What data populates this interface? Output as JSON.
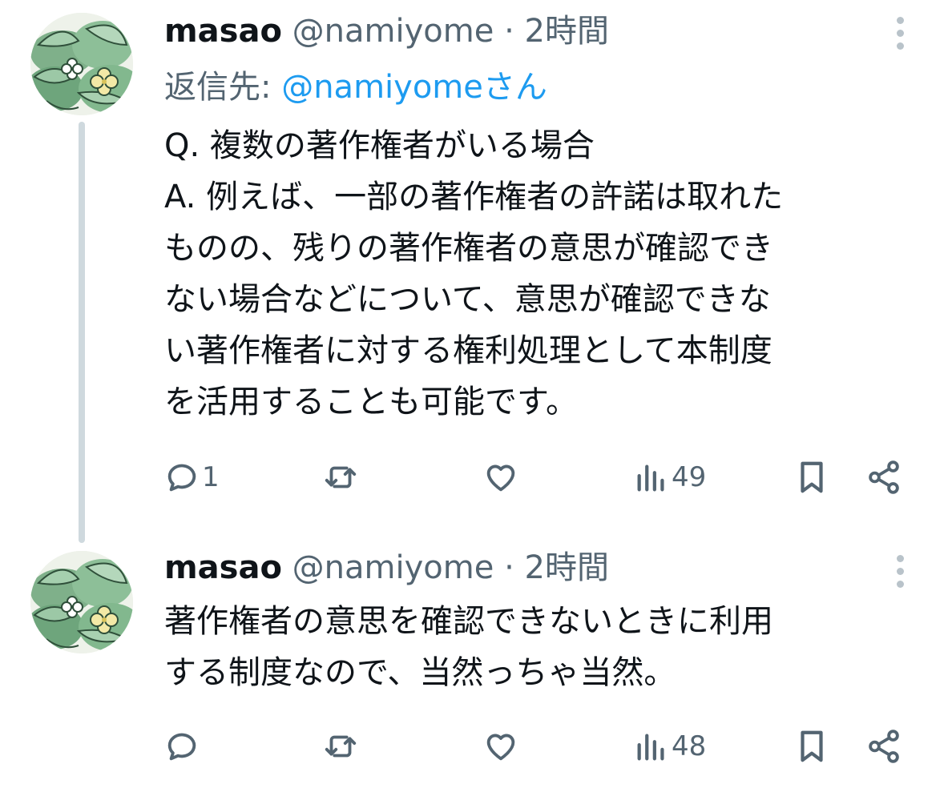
{
  "tweets": [
    {
      "display_name": "masao",
      "handle": "@namiyome",
      "separator": "·",
      "time": "2時間",
      "replying_prefix": "返信先:",
      "replying_to": "@namiyomeさん",
      "body_lines": [
        "Q. 複数の著作権者がいる場合",
        "A. 例えば、一部の著作権者の許諾は取れた",
        "ものの、残りの著作権者の意思が確認でき",
        "ない場合などについて、意思が確認できな",
        "い著作権者に対する権利処理として本制度",
        "を活用することも可能です。"
      ],
      "actions": {
        "reply_icon": "speech-bubble-icon",
        "reply_count": "1",
        "retweet_icon": "retweet-icon",
        "like_icon": "heart-icon",
        "views_icon": "bar-chart-icon",
        "views_count": "49",
        "bookmark_icon": "bookmark-icon",
        "share_icon": "share-icon"
      }
    },
    {
      "display_name": "masao",
      "handle": "@namiyome",
      "separator": "·",
      "time": "2時間",
      "body_lines": [
        "著作権者の意思を確認できないときに利用",
        "する制度なので、当然っちゃ当然。"
      ],
      "actions": {
        "reply_icon": "speech-bubble-icon",
        "retweet_icon": "retweet-icon",
        "like_icon": "heart-icon",
        "views_icon": "bar-chart-icon",
        "views_count": "48",
        "bookmark_icon": "bookmark-icon",
        "share_icon": "share-icon"
      }
    }
  ],
  "colors": {
    "text": "#0f1419",
    "secondary": "#536471",
    "link": "#1d9bf0",
    "thread_line": "#cfd9de",
    "icon": "#536471"
  }
}
